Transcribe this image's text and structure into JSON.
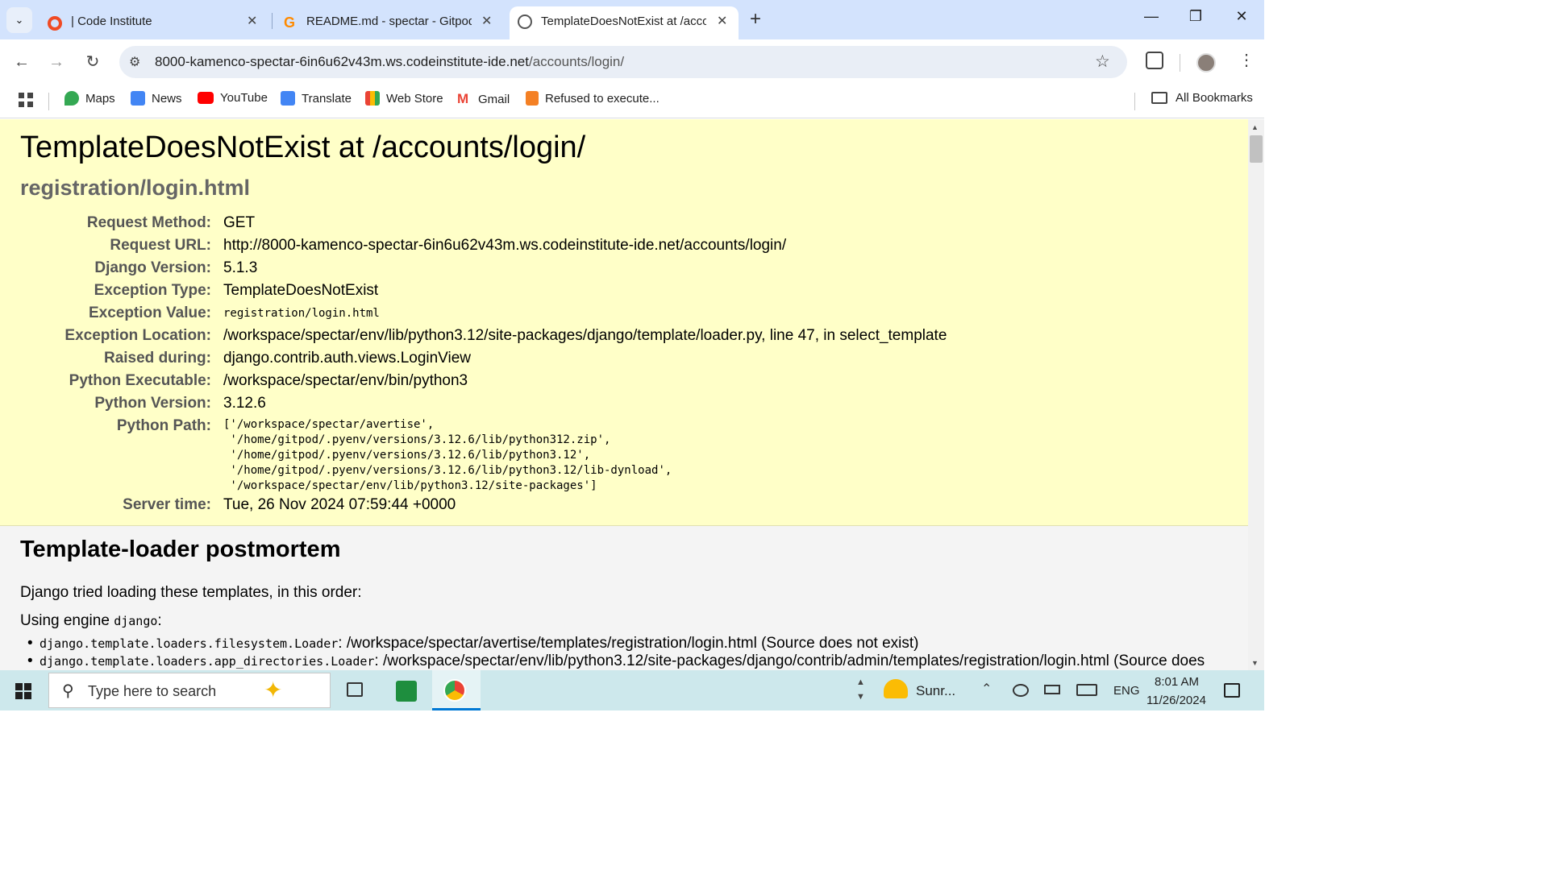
{
  "browser": {
    "tabs": [
      {
        "title": "| Code Institute",
        "icon": "code-institute-icon",
        "close": "✕"
      },
      {
        "title": "README.md - spectar - Gitpod",
        "icon": "gitpod-icon",
        "close": "✕"
      },
      {
        "title": "TemplateDoesNotExist at /accou",
        "icon": "globe-icon",
        "close": "✕",
        "active": true
      }
    ],
    "new_tab": "+",
    "window_controls": {
      "minimize": "—",
      "restore": "❐",
      "close": "✕"
    },
    "url_host": "8000-kamenco-spectar-6in6u62v43m.ws.codeinstitute-ide.net",
    "url_path": "/accounts/login/",
    "bookmarks": [
      {
        "label": "Maps",
        "color": "#34a853"
      },
      {
        "label": "News",
        "color": "#4285f4"
      },
      {
        "label": "YouTube",
        "color": "#ff0000"
      },
      {
        "label": "Translate",
        "color": "#4285f4"
      },
      {
        "label": "Web Store",
        "color": "#ea4335"
      },
      {
        "label": "Gmail",
        "color": "#ea4335"
      },
      {
        "label": "Refused to execute...",
        "color": "#f48024"
      }
    ],
    "all_bookmarks": "All Bookmarks"
  },
  "page": {
    "title": "TemplateDoesNotExist at /accounts/login/",
    "subtitle": "registration/login.html",
    "meta": [
      {
        "key": "Request Method:",
        "value": "GET"
      },
      {
        "key": "Request URL:",
        "value": "http://8000-kamenco-spectar-6in6u62v43m.ws.codeinstitute-ide.net/accounts/login/"
      },
      {
        "key": "Django Version:",
        "value": "5.1.3"
      },
      {
        "key": "Exception Type:",
        "value": "TemplateDoesNotExist"
      },
      {
        "key": "Exception Value:",
        "value": "registration/login.html",
        "mono": true
      },
      {
        "key": "Exception Location:",
        "value": "/workspace/spectar/env/lib/python3.12/site-packages/django/template/loader.py, line 47, in select_template"
      },
      {
        "key": "Raised during:",
        "value": "django.contrib.auth.views.LoginView"
      },
      {
        "key": "Python Executable:",
        "value": "/workspace/spectar/env/bin/python3"
      },
      {
        "key": "Python Version:",
        "value": "3.12.6"
      },
      {
        "key": "Python Path:",
        "value": ""
      },
      {
        "key": "Server time:",
        "value": "Tue, 26 Nov 2024 07:59:44 +0000"
      }
    ],
    "python_path": [
      "['/workspace/spectar/avertise',",
      " '/home/gitpod/.pyenv/versions/3.12.6/lib/python312.zip',",
      " '/home/gitpod/.pyenv/versions/3.12.6/lib/python3.12',",
      " '/home/gitpod/.pyenv/versions/3.12.6/lib/python3.12/lib-dynload',",
      " '/workspace/spectar/env/lib/python3.12/site-packages']"
    ],
    "postmortem": {
      "title": "Template-loader postmortem",
      "intro": "Django tried loading these templates, in this order:",
      "engine_prefix": "Using engine ",
      "engine_name": "django",
      "engine_suffix": ":",
      "loaders": [
        {
          "loader": "django.template.loaders.filesystem.Loader",
          "sep": ": ",
          "path": "/workspace/spectar/avertise/templates/registration/login.html (Source does not exist)"
        },
        {
          "loader": "django.template.loaders.app_directories.Loader",
          "sep": ": ",
          "path": "/workspace/spectar/env/lib/python3.12/site-packages/django/contrib/admin/templates/registration/login.html (Source does"
        }
      ]
    }
  },
  "taskbar": {
    "search_placeholder": "Type here to search",
    "weather": "Sunr...",
    "language": "ENG",
    "time": "8:01 AM",
    "date": "11/26/2024"
  }
}
